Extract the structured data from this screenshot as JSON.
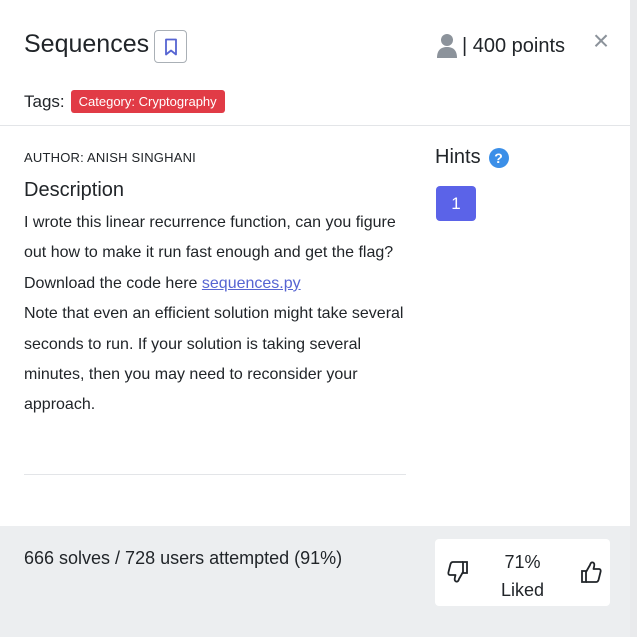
{
  "challenge": {
    "title": "Sequences",
    "points_text": "| 400 points",
    "close_symbol": "×",
    "tags_label": "Tags:",
    "tag": "Category: Cryptography"
  },
  "description": {
    "author": "AUTHOR: ANISH SINGHANI",
    "heading": "Description",
    "line1": "I wrote this linear recurrence function, can you figure out how to make it run fast enough and get the flag?",
    "download_prefix": "Download the code here ",
    "download_link": "sequences.py",
    "line3": "Note that even an efficient solution might take several seconds to run. If your solution is taking several minutes, then you may need to reconsider your approach."
  },
  "hints": {
    "title": "Hints",
    "help_symbol": "?",
    "items": [
      "1"
    ]
  },
  "stats": {
    "solves_text": "666 solves / 728 users attempted (91%)",
    "liked_percent": "71%",
    "liked_label": "Liked"
  },
  "colors": {
    "tag_bg": "#e13b46",
    "hint_button_bg": "#5b63e8",
    "help_icon_bg": "#3b8fe8",
    "link": "#5664d2",
    "footer_bg": "#eceef0"
  },
  "icons": [
    "bookmark-icon",
    "user-icon",
    "close-icon",
    "help-icon",
    "thumbs-down-icon",
    "thumbs-up-icon"
  ]
}
